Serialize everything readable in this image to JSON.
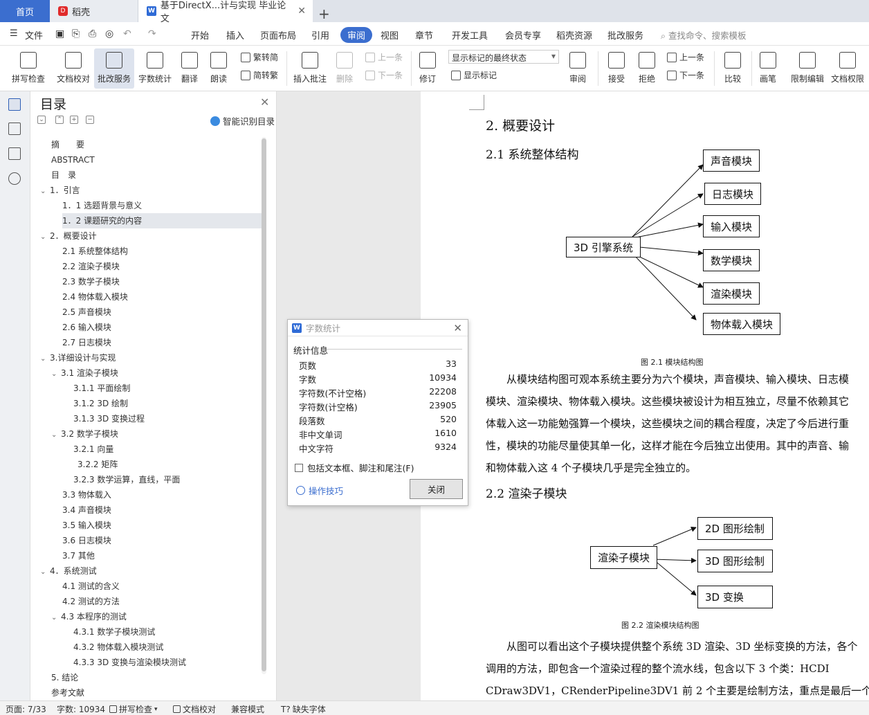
{
  "tabs": {
    "home": "首页",
    "docer": "稻壳",
    "document": "基于DirectX...计与实现 毕业论文"
  },
  "menu": {
    "file": "文件",
    "items": [
      "开始",
      "插入",
      "页面布局",
      "引用",
      "审阅",
      "视图",
      "章节",
      "开发工具",
      "会员专享",
      "稻壳资源",
      "批改服务"
    ],
    "active": "审阅",
    "search_placeholder": "查找命令、搜索模板"
  },
  "toolbar": {
    "spellcheck": "拼写检查",
    "doc_proof": "文档校对",
    "grading": "批改服务",
    "word_count": "字数统计",
    "translate": "翻译",
    "read_aloud": "朗读",
    "trad_conv": "繁转简",
    "simp_conv": "简转繁",
    "insert_comment": "插入批注",
    "delete": "删除",
    "prev_comment": "上一条",
    "next_comment": "下一条",
    "track_changes": "修订",
    "markup_state": "显示标记的最终状态",
    "show_markup": "显示标记",
    "review": "审阅",
    "accept": "接受",
    "reject": "拒绝",
    "prev_change": "上一条",
    "next_change": "下一条",
    "compare": "比较",
    "pen": "画笔",
    "restrict_edit": "限制编辑",
    "doc_permission": "文档权限"
  },
  "nav": {
    "title": "目录",
    "smart_toc": "智能识别目录",
    "items": [
      {
        "label": "摘　　要",
        "level": 0,
        "caret": ""
      },
      {
        "label": "ABSTRACT",
        "level": 0,
        "caret": ""
      },
      {
        "label": "目　录",
        "level": 0,
        "caret": ""
      },
      {
        "label": "1．引言",
        "level": 0,
        "caret": "v"
      },
      {
        "label": "1．1 选题背景与意义",
        "level": 1,
        "caret": ""
      },
      {
        "label": "1．2  课题研究的内容",
        "level": 1,
        "caret": "",
        "selected": true
      },
      {
        "label": "2．概要设计",
        "level": 0,
        "caret": "v"
      },
      {
        "label": "2.1  系统整体结构",
        "level": 1,
        "caret": ""
      },
      {
        "label": "2.2  渲染子模块",
        "level": 1,
        "caret": ""
      },
      {
        "label": "2.3  数学子模块",
        "level": 1,
        "caret": ""
      },
      {
        "label": "2.4  物体载入模块",
        "level": 1,
        "caret": ""
      },
      {
        "label": "2.5  声音模块",
        "level": 1,
        "caret": ""
      },
      {
        "label": "2.6  输入模块",
        "level": 1,
        "caret": ""
      },
      {
        "label": "2.7  日志模块",
        "level": 1,
        "caret": ""
      },
      {
        "label": "3.详细设计与实现",
        "level": 0,
        "caret": "v"
      },
      {
        "label": "3.1  渲染子模块",
        "level": 1,
        "caret": "v"
      },
      {
        "label": "3.1.1  平面绘制",
        "level": 2,
        "caret": ""
      },
      {
        "label": "3.1.2 3D 绘制",
        "level": 2,
        "caret": ""
      },
      {
        "label": "3.1.3 3D 变换过程",
        "level": 2,
        "caret": ""
      },
      {
        "label": "3.2  数学子模块",
        "level": 1,
        "caret": "v"
      },
      {
        "label": "3.2.1  向量",
        "level": 2,
        "caret": ""
      },
      {
        "label": "3.2.2  矩阵",
        "level": 2,
        "caret": "",
        "indent": 6
      },
      {
        "label": "3.2.3  数学运算，直线，平面",
        "level": 2,
        "caret": ""
      },
      {
        "label": "3.3  物体载入",
        "level": 1,
        "caret": ""
      },
      {
        "label": "3.4  声音模块",
        "level": 1,
        "caret": ""
      },
      {
        "label": "3.5  输入模块",
        "level": 1,
        "caret": ""
      },
      {
        "label": "3.6  日志模块",
        "level": 1,
        "caret": ""
      },
      {
        "label": "3.7  其他",
        "level": 1,
        "caret": ""
      },
      {
        "label": "4．系统测试",
        "level": 0,
        "caret": "v"
      },
      {
        "label": "4.1  测试的含义",
        "level": 1,
        "caret": ""
      },
      {
        "label": "4.2  测试的方法",
        "level": 1,
        "caret": ""
      },
      {
        "label": "4.3 本程序的测试",
        "level": 1,
        "caret": "v"
      },
      {
        "label": "4.3.1  数学子模块测试",
        "level": 2,
        "caret": ""
      },
      {
        "label": "4.3.2  物体载入模块测试",
        "level": 2,
        "caret": ""
      },
      {
        "label": "4.3.3 3D 变换与渲染模块测试",
        "level": 2,
        "caret": ""
      },
      {
        "label": "5. 结论",
        "level": 0,
        "caret": ""
      },
      {
        "label": "参考文献",
        "level": 0,
        "caret": ""
      }
    ]
  },
  "dialog": {
    "title": "字数统计",
    "section": "统计信息",
    "stats": [
      {
        "label": "页数",
        "value": "33"
      },
      {
        "label": "字数",
        "value": "10934"
      },
      {
        "label": "字符数(不计空格)",
        "value": "22208"
      },
      {
        "label": "字符数(计空格)",
        "value": "23905"
      },
      {
        "label": "段落数",
        "value": "520"
      },
      {
        "label": "非中文单词",
        "value": "1610"
      },
      {
        "label": "中文字符",
        "value": "9324"
      }
    ],
    "include_checkbox": "包括文本框、脚注和尾注(F)",
    "include_checked": false,
    "tips": "操作技巧",
    "close": "关闭"
  },
  "page": {
    "h1": "2.  概要设计",
    "h2_1": "2.1  系统整体结构",
    "fig1": {
      "root": "3D 引擎系统",
      "nodes": [
        "声音模块",
        "日志模块",
        "输入模块",
        "数学模块",
        "渲染模块",
        "物体载入模块"
      ],
      "caption": "图 2.1  模块结构图"
    },
    "para1": [
      "　　从模块结构图可观本系统主要分为六个模块，声音模块、输入模块、日志模",
      "模块、渲染模块、物体载入模块。这些模块被设计为相互独立，尽量不依赖其它",
      "体载入这一功能勉强算一个模块，这些模块之间的耦合程度，决定了今后进行重",
      "性，模块的功能尽量使其单一化，这样才能在今后独立出使用。其中的声音、输",
      "和物体载入这 4 个子模块几乎是完全独立的。"
    ],
    "h2_2": "2.2  渲染子模块",
    "fig2": {
      "root": "渲染子模块",
      "nodes": [
        "2D 图形绘制",
        "3D 图形绘制",
        "3D 变换"
      ],
      "caption": "图 2.2  渲染模块结构图"
    },
    "para2": [
      "　　从图可以看出这个子模块提供整个系统 3D 渲染、3D 坐标变换的方法，各个",
      "调用的方法，即包含一个渲染过程的整个流水线，包含以下 3 个类：HCDI",
      "CDraw3DV1，CRenderPipeline3DV1  前 2 个主要是绘制方法，重点是最后一个"
    ]
  },
  "status": {
    "page": "页面: 7/33",
    "words": "字数: 10934",
    "spell": "拼写检查",
    "proof": "文档校对",
    "compat": "兼容模式",
    "missing_font": "缺失字体"
  }
}
